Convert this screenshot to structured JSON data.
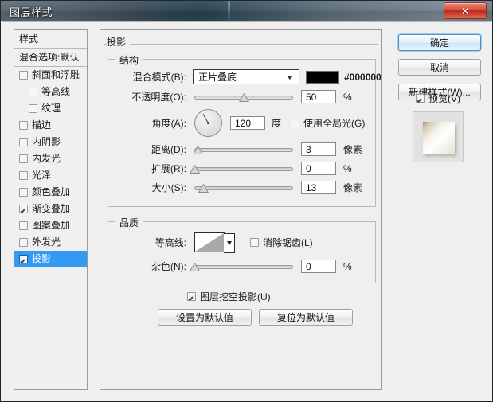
{
  "window": {
    "title": "图层样式",
    "close_label": "✕"
  },
  "sidebar": {
    "header": "样式",
    "blending_options": "混合选项:默认",
    "items": [
      {
        "label": "斜面和浮雕",
        "checked": false,
        "indent": false,
        "selected": false
      },
      {
        "label": "等高线",
        "checked": false,
        "indent": true,
        "selected": false
      },
      {
        "label": "纹理",
        "checked": false,
        "indent": true,
        "selected": false
      },
      {
        "label": "描边",
        "checked": false,
        "indent": false,
        "selected": false
      },
      {
        "label": "内阴影",
        "checked": false,
        "indent": false,
        "selected": false
      },
      {
        "label": "内发光",
        "checked": false,
        "indent": false,
        "selected": false
      },
      {
        "label": "光泽",
        "checked": false,
        "indent": false,
        "selected": false
      },
      {
        "label": "颜色叠加",
        "checked": false,
        "indent": false,
        "selected": false
      },
      {
        "label": "渐变叠加",
        "checked": true,
        "indent": false,
        "selected": false
      },
      {
        "label": "图案叠加",
        "checked": false,
        "indent": false,
        "selected": false
      },
      {
        "label": "外发光",
        "checked": false,
        "indent": false,
        "selected": false
      },
      {
        "label": "投影",
        "checked": true,
        "indent": false,
        "selected": true
      }
    ]
  },
  "panel": {
    "title": "投影",
    "structure": {
      "legend": "结构",
      "blend_mode_label": "混合模式(B):",
      "blend_mode_value": "正片叠底",
      "color_hex": "#000000",
      "color_swatch": "#000000",
      "opacity_label": "不透明度(O):",
      "opacity_value": "50",
      "opacity_unit": "%",
      "opacity_pct": 50,
      "angle_label": "角度(A):",
      "angle_value": "120",
      "angle_unit": "度",
      "angle_deg": 120,
      "global_light_label": "使用全局光(G)",
      "global_light_checked": false,
      "distance_label": "距离(D):",
      "distance_value": "3",
      "distance_unit": "像素",
      "distance_pct": 3,
      "spread_label": "扩展(R):",
      "spread_value": "0",
      "spread_unit": "%",
      "spread_pct": 0,
      "size_label": "大小(S):",
      "size_value": "13",
      "size_unit": "像素",
      "size_pct": 9
    },
    "quality": {
      "legend": "品质",
      "contour_label": "等高线:",
      "antialias_label": "消除锯齿(L)",
      "antialias_checked": false,
      "noise_label": "杂色(N):",
      "noise_value": "0",
      "noise_unit": "%",
      "noise_pct": 0
    },
    "knockout_label": "图层挖空投影(U)",
    "knockout_checked": true,
    "make_default_label": "设置为默认值",
    "reset_default_label": "复位为默认值"
  },
  "actions": {
    "ok_label": "确定",
    "cancel_label": "取消",
    "new_style_label": "新建样式(W)...",
    "preview_label": "预览(V)",
    "preview_checked": true
  }
}
